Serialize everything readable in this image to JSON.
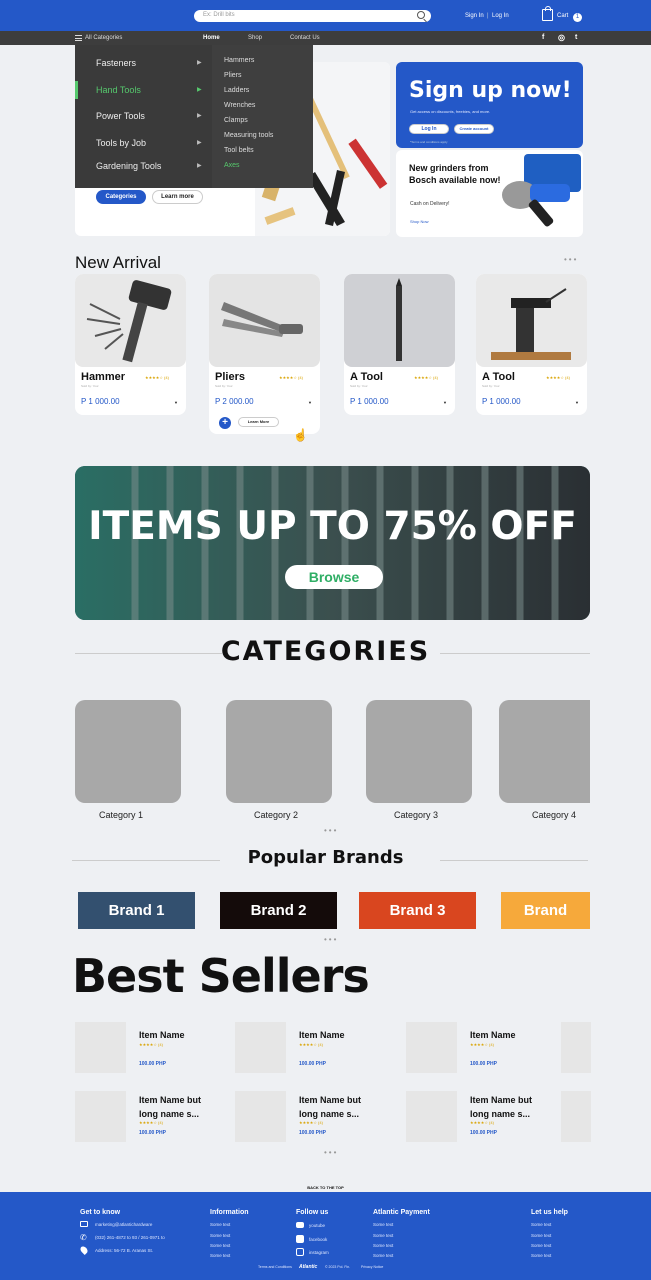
{
  "header": {
    "search_placeholder": "Ex: Drill bits",
    "sign_in": "Sign In",
    "separator": "|",
    "log_in": "Log In",
    "cart_label": "Cart",
    "cart_count": "1"
  },
  "nav": {
    "all_categories": "All Categories",
    "home": "Home",
    "shop": "Shop",
    "contact": "Contact Us",
    "social": [
      "f",
      "◎",
      "t"
    ]
  },
  "menu": {
    "categories": [
      {
        "label": "Fasteners"
      },
      {
        "label": "Hand Tools"
      },
      {
        "label": "Power Tools"
      },
      {
        "label": "Tools by  Job"
      },
      {
        "label": "Gardening Tools"
      }
    ],
    "subitems": [
      "Hammers",
      "Pliers",
      "Ladders",
      "Wrenches",
      "Clamps",
      "Measuring tools",
      "Tool belts",
      "Axes"
    ]
  },
  "hero": {
    "categories_btn": "Categories",
    "learn_more_btn": "Learn more"
  },
  "signup": {
    "title": "Sign up now!",
    "subtitle": "Get access on discounts, freebies, and more.",
    "login_btn": "Log In",
    "create_btn": "Create account",
    "fine_print": "*Terms and conditions apply"
  },
  "grinder": {
    "title": "New grinders from Bosch available now!",
    "subtitle": "Cash on Delivery!",
    "link": "Shop Now"
  },
  "new_arrival": {
    "title": "New Arrival",
    "products": [
      {
        "name": "Hammer",
        "sub": "Sold by: Your",
        "stars": "★★★★☆ (4)",
        "price": "P 1 000.00",
        "caret": "▼"
      },
      {
        "name": "Pliers",
        "sub": "Sold by: Your",
        "stars": "★★★★☆ (4)",
        "price": "P 2 000.00",
        "caret": "▼"
      },
      {
        "name": "A Tool",
        "sub": "Sold by: Your",
        "stars": "★★★★☆ (4)",
        "price": "P 1 000.00",
        "caret": "▼"
      },
      {
        "name": "A Tool",
        "sub": "Sold by: Your",
        "stars": "★★★★☆ (4)",
        "price": "P 1 000.00",
        "caret": "▼"
      }
    ],
    "hover_add": "+",
    "hover_learn": "Learn More"
  },
  "promo": {
    "title": "ITEMS UP TO 75% OFF",
    "browse": "Browse"
  },
  "categories": {
    "title": "CATEGORIES",
    "items": [
      "Category 1",
      "Category 2",
      "Category 3",
      "Category 4"
    ]
  },
  "brands": {
    "title": "Popular  Brands",
    "items": [
      {
        "label": "Brand 1",
        "color": "#33506f"
      },
      {
        "label": "Brand 2",
        "color": "#140b0a"
      },
      {
        "label": "Brand 3",
        "color": "#d9461f"
      },
      {
        "label": "Brand",
        "color": "#f6a93b"
      }
    ]
  },
  "best_sellers": {
    "title": "Best Sellers",
    "row1": [
      {
        "name": "Item Name",
        "stars": "★★★★☆ (4)",
        "price": "100.00 PHP"
      },
      {
        "name": "Item Name",
        "stars": "★★★★☆ (4)",
        "price": "100.00 PHP"
      },
      {
        "name": "Item Name",
        "stars": "★★★★☆ (4)",
        "price": "100.00 PHP"
      }
    ],
    "row2": [
      {
        "name": "Item Name but long name s...",
        "stars": "★★★★☆ (4)",
        "price": "100.00 PHP"
      },
      {
        "name": "Item Name but long name s...",
        "stars": "★★★★☆ (4)",
        "price": "100.00 PHP"
      },
      {
        "name": "Item Name but long name s...",
        "stars": "★★★★☆ (4)",
        "price": "100.00 PHP"
      }
    ]
  },
  "footer": {
    "back_to_top": "BACK TO THE TOP",
    "get_to_know": "Get to know",
    "email": "marketing@atlantichardware",
    "phone": "(032) 261-4872 to 93 / 261-0971 to",
    "address": "Address: 56-72 B. Aranas St.",
    "information": "Information",
    "follow_us": "Follow us",
    "youtube": "youtube",
    "facebook": "facebook",
    "instagram": "instagram",
    "atlantic_payment": "Atlantic Payment",
    "let_us_help": "Let us help",
    "some_text": "Some text",
    "bottom_terms": "Terms and Conditions",
    "bottom_logo": "Atlantic",
    "bottom_copy": "© 2023 Pol. Fin.",
    "bottom_privacy": "Privacy Notice"
  },
  "colors": {
    "brand_blue": "#2458c8",
    "accent_green": "#56c96d",
    "nav_dark": "#3d3d3d"
  }
}
